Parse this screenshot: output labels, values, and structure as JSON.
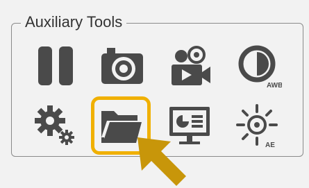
{
  "panel": {
    "title": "Auxiliary Tools"
  },
  "tools": [
    {
      "name": "pause",
      "icon": "pause-icon"
    },
    {
      "name": "snapshot",
      "icon": "camera-icon"
    },
    {
      "name": "record",
      "icon": "video-camera-icon"
    },
    {
      "name": "awb",
      "icon": "auto-white-balance-icon",
      "badge": "AWB"
    },
    {
      "name": "settings",
      "icon": "gears-icon"
    },
    {
      "name": "open-folder",
      "icon": "folder-icon",
      "selected": true
    },
    {
      "name": "display",
      "icon": "monitor-icon"
    },
    {
      "name": "ae",
      "icon": "auto-exposure-icon",
      "badge": "AE"
    }
  ],
  "colors": {
    "icon": "#4a4a4a",
    "selection": "#f0b000",
    "cursor": "#c8960a",
    "background": "#f2f2f2"
  }
}
